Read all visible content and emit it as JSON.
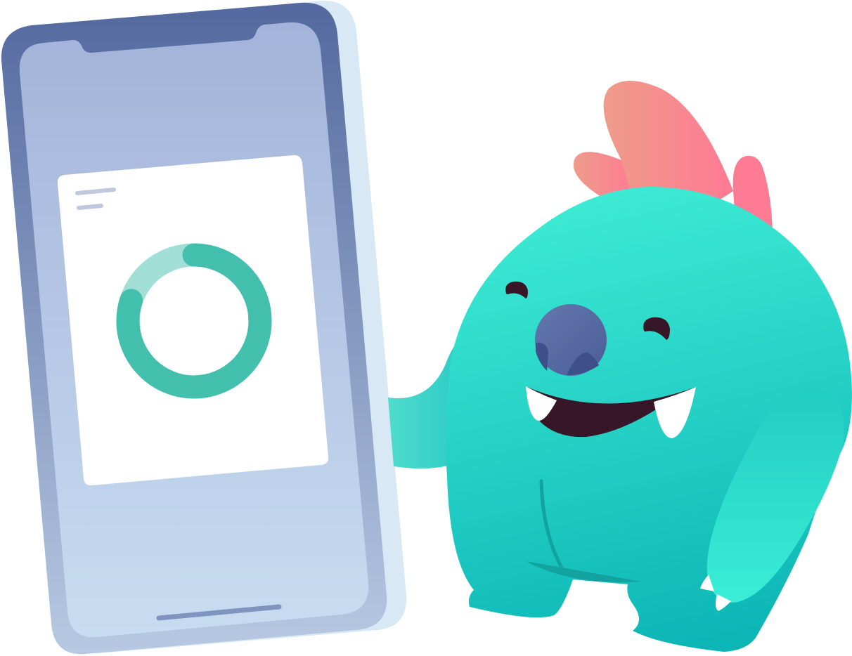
{
  "illustration": {
    "subject": "phone-with-progress-ring-and-monster-mascot",
    "icon_names": [
      "smartphone-icon",
      "progress-ring-icon",
      "monster-mascot-icon"
    ],
    "progress_ring": {
      "fraction": 0.8
    },
    "colors": {
      "phone_frame_top": "#53699f",
      "phone_frame_bottom": "#b7c9e2",
      "phone_back": "#d8e8f4",
      "screen_top": "#a3b3d9",
      "screen_bottom": "#c8dcf1",
      "card": "#ffffff",
      "card_text_lines": "#bfc8dc",
      "ring_track": "#a1dfd6",
      "ring_fill": "#43bfae",
      "home_indicator": "#7f95c0",
      "monster_body_top": "#3eebd4",
      "monster_body_bottom": "#0cb6b6",
      "monster_spikes_left": "#ee9c8a",
      "monster_spikes_right": "#ff7a93",
      "monster_nose": "#51639e",
      "monster_mouth": "#371628",
      "monster_teeth": "#ffffff",
      "monster_eyes": "#371628",
      "monster_line": "#12a3a0"
    }
  }
}
